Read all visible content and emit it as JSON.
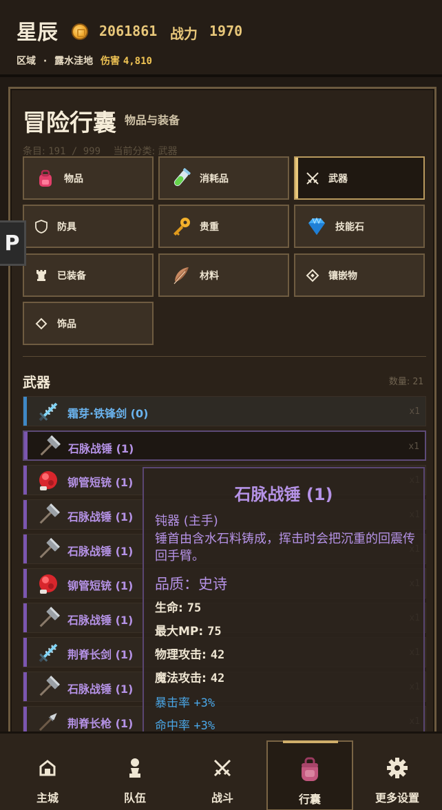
{
  "header": {
    "player_name": "星辰",
    "gold": "2061861",
    "power_label": "战力",
    "power_value": "1970",
    "region_label": "区域",
    "separator": "·",
    "region_name": "露水洼地",
    "damage_label": "伤害",
    "damage_value": "4,810",
    "coin_icon": "coin-icon"
  },
  "side_tab": {
    "label": "P"
  },
  "panel": {
    "title": "冒险行囊",
    "subtitle": "物品与装备",
    "count_label": "条目:",
    "count_value": "191 / 999",
    "category_label": "当前分类:",
    "category_value": "武器"
  },
  "categories": [
    {
      "label": "物品",
      "icon": "backpack-icon"
    },
    {
      "label": "消耗品",
      "icon": "potion-icon"
    },
    {
      "label": "武器",
      "icon": "crossed-swords-icon",
      "active": true
    },
    {
      "label": "防具",
      "icon": "shield-icon"
    },
    {
      "label": "贵重",
      "icon": "key-icon"
    },
    {
      "label": "技能石",
      "icon": "gem-icon"
    },
    {
      "label": "已装备",
      "icon": "rook-icon"
    },
    {
      "label": "材料",
      "icon": "feather-icon"
    },
    {
      "label": "镶嵌物",
      "icon": "diamond-outline-icon"
    },
    {
      "label": "饰品",
      "icon": "diamond-outline-icon"
    }
  ],
  "section": {
    "title": "武器",
    "count_label": "数量:",
    "count_value": "21"
  },
  "items": [
    {
      "name": "霜芽·铁锋剑 (0)",
      "qty": "x1",
      "icon": "ice-sword-icon",
      "rarity": "blue"
    },
    {
      "name": "石脉战锤 (1)",
      "qty": "x1",
      "icon": "hammer-icon",
      "rarity": "purple",
      "selected": true
    },
    {
      "name": "铆管短铳 (1)",
      "qty": "x1",
      "icon": "red-gun-icon",
      "rarity": "purple"
    },
    {
      "name": "石脉战锤 (1)",
      "qty": "x1",
      "icon": "hammer-icon",
      "rarity": "purple"
    },
    {
      "name": "石脉战锤 (1)",
      "qty": "x1",
      "icon": "hammer-icon",
      "rarity": "purple"
    },
    {
      "name": "铆管短铳 (1)",
      "qty": "x1",
      "icon": "red-gun-icon",
      "rarity": "purple"
    },
    {
      "name": "石脉战锤 (1)",
      "qty": "x1",
      "icon": "hammer-icon",
      "rarity": "purple"
    },
    {
      "name": "荆脊长剑 (1)",
      "qty": "x1",
      "icon": "ice-sword-icon",
      "rarity": "purple"
    },
    {
      "name": "石脉战锤 (1)",
      "qty": "x1",
      "icon": "hammer-icon",
      "rarity": "purple"
    },
    {
      "name": "荆脊长枪 (1)",
      "qty": "x1",
      "icon": "spear-icon",
      "rarity": "purple"
    }
  ],
  "tooltip": {
    "title": "石脉战锤 (1)",
    "type": "钝器 (主手)",
    "description": "锤首由含水石料铸成，挥击时会把沉重的回震传回手臂。",
    "quality": "品质：史诗",
    "stats": [
      {
        "label": "生命:",
        "value": "75"
      },
      {
        "label": "最大MP:",
        "value": "75"
      },
      {
        "label": "物理攻击:",
        "value": "42"
      },
      {
        "label": "魔法攻击:",
        "value": "42"
      }
    ],
    "bonuses": [
      {
        "label": "暴击率",
        "value": "+3%"
      },
      {
        "label": "命中率",
        "value": "+3%"
      }
    ]
  },
  "nav": [
    {
      "label": "主城",
      "icon": "house-icon"
    },
    {
      "label": "队伍",
      "icon": "pawn-icon"
    },
    {
      "label": "战斗",
      "icon": "crossed-swords-icon"
    },
    {
      "label": "行囊",
      "icon": "backpack-icon",
      "active": true
    },
    {
      "label": "更多设置",
      "icon": "gear-icon"
    }
  ],
  "colors": {
    "background": "#211a14",
    "gold_text": "#e8c77a",
    "epic_purple": "#b592e6",
    "rare_blue": "#6ab3ee",
    "bonus_blue": "#4aa6e6"
  }
}
